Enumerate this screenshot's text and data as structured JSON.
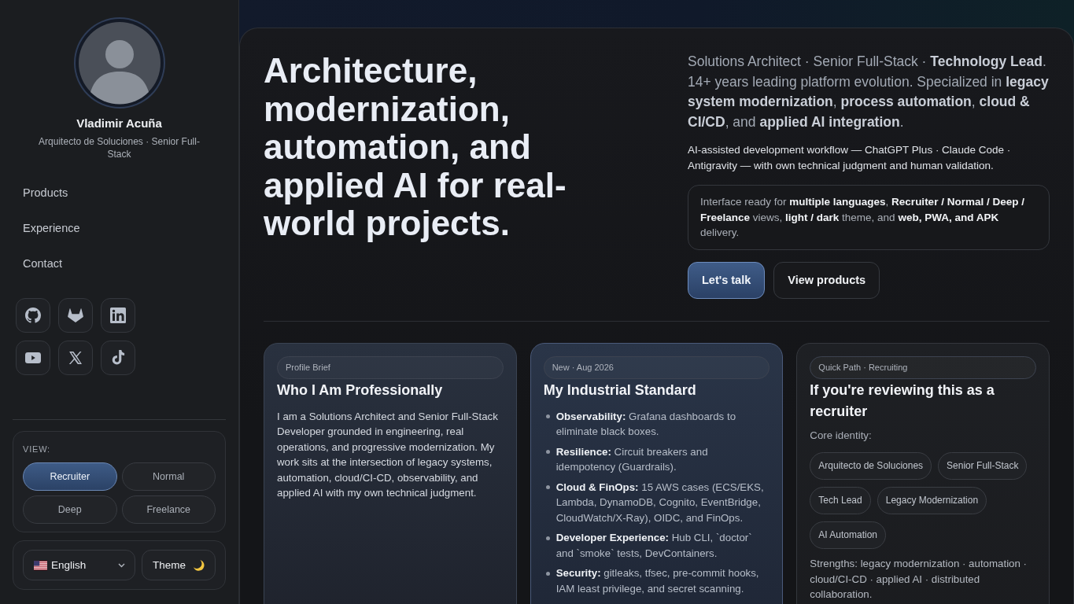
{
  "sidebar": {
    "profile": {
      "name": "Vladimir Acuña",
      "title": "Arquitecto de Soluciones · Senior Full-Stack"
    },
    "nav": [
      {
        "label": "Products"
      },
      {
        "label": "Experience"
      },
      {
        "label": "Contact"
      }
    ],
    "view_selector": {
      "label": "VIEW:",
      "options": [
        {
          "label": "Recruiter",
          "selected": true
        },
        {
          "label": "Normal",
          "selected": false
        },
        {
          "label": "Deep",
          "selected": false
        },
        {
          "label": "Freelance",
          "selected": false
        }
      ]
    },
    "language_select": {
      "value": "English"
    },
    "theme_button": {
      "label": "Theme"
    }
  },
  "hero": {
    "heading": "Architecture, modernization, automation, and applied AI for real-world projects.",
    "lead": "Solutions Architect · Senior Full-Stack · **Technology Lead**. 14+ years leading platform evolution. Specialized in **legacy system modernization**, **process automation**, **cloud & CI/CD**, and **applied AI integration**.",
    "workflow_note": "AI-assisted development workflow — ChatGPT Plus · Claude Code · Antigravity — with own technical judgment and human validation.",
    "feature_note": "Interface ready for **multiple languages**, **Recruiter / Normal / Deep / Freelance** views, **light / dark** theme, and **web, PWA, and APK** delivery.",
    "buttons": [
      {
        "label": "Let's talk",
        "kind": "primary"
      },
      {
        "label": "View products",
        "kind": "secondary"
      }
    ]
  },
  "cards": [
    {
      "kind": "text",
      "badge": "Profile Brief",
      "title": "Who I Am Professionally",
      "body": "I am a Solutions Architect and Senior Full-Stack Developer grounded in engineering, real operations, and progressive modernization. My work sits at the intersection of legacy systems, automation, cloud/CI-CD, observability, and applied AI with my own technical judgment."
    },
    {
      "kind": "list",
      "badge": "New · Aug 2026",
      "title": "My Industrial Standard",
      "items": [
        "**Observability:** Grafana dashboards to eliminate black boxes.",
        "**Resilience:** Circuit breakers and idempotency (Guardrails).",
        "**Cloud & FinOps:** 15 AWS cases (ECS/EKS, Lambda, DynamoDB, Cognito, EventBridge, CloudWatch/X-Ray), OIDC, and FinOps.",
        "**Developer Experience:** Hub CLI, `doctor` and `smoke` tests, DevContainers.",
        "**Security:** gitleaks, tfsec, pre-commit hooks, IAM least privilege, and secret scanning."
      ]
    },
    {
      "kind": "chips",
      "badge": "Quick Path · Recruiting",
      "title": "If you're reviewing this as a recruiter",
      "intro": "Core identity:",
      "chips": [
        "Arquitecto de Soluciones",
        "Senior Full-Stack",
        "Tech Lead",
        "Legacy Modernization",
        "AI Automation"
      ],
      "footer": "Strengths: legacy modernization · automation · cloud/CI-CD · applied AI · distributed collaboration."
    }
  ]
}
